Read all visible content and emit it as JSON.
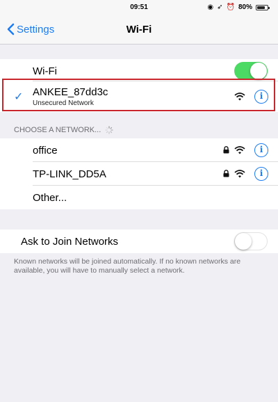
{
  "status": {
    "time": "09:51",
    "battery": "80%",
    "battery_level": 0.8
  },
  "nav": {
    "back_label": "Settings",
    "title": "Wi-Fi"
  },
  "wifi_toggle": {
    "label": "Wi-Fi",
    "on": true
  },
  "connected": {
    "name": "ANKEE_87dd3c",
    "subtitle": "Unsecured Network"
  },
  "choose": {
    "header": "CHOOSE A NETWORK...",
    "networks": [
      {
        "name": "office",
        "locked": true
      },
      {
        "name": "TP-LINK_DD5A",
        "locked": true
      },
      {
        "name": "Other...",
        "locked": false
      }
    ]
  },
  "ask_to_join": {
    "label": "Ask to Join Networks",
    "on": false,
    "footer": "Known networks will be joined automatically. If no known networks are available, you will have to manually select a network."
  },
  "colors": {
    "accent": "#1a7cf5",
    "toggle_on": "#4cd964",
    "highlight": "#c8252c"
  }
}
